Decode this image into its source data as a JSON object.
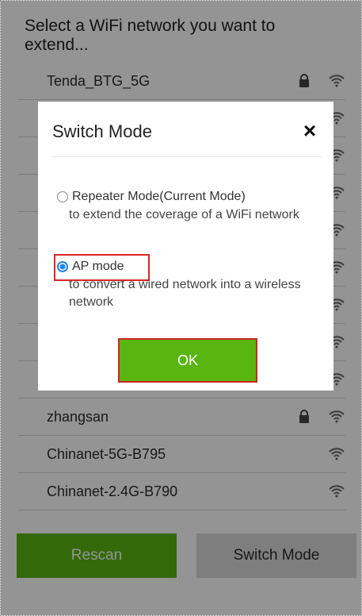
{
  "screen": {
    "title": "Select a WiFi network you want to extend..."
  },
  "networks": [
    {
      "name": "Tenda_BTG_5G",
      "locked": true
    },
    {
      "name": "",
      "locked": false
    },
    {
      "name": "",
      "locked": false
    },
    {
      "name": "",
      "locked": false
    },
    {
      "name": "",
      "locked": false
    },
    {
      "name": "",
      "locked": false
    },
    {
      "name": "",
      "locked": false
    },
    {
      "name": "",
      "locked": false
    },
    {
      "name": "",
      "locked": false
    },
    {
      "name": "zhangsan",
      "locked": true
    },
    {
      "name": "Chinanet-5G-B795",
      "locked": false
    },
    {
      "name": "Chinanet-2.4G-B790",
      "locked": false
    }
  ],
  "footer": {
    "rescan_label": "Rescan",
    "switch_mode_label": "Switch Mode"
  },
  "dialog": {
    "title": "Switch Mode",
    "close_label": "×",
    "repeater_label": "Repeater Mode(Current Mode)",
    "repeater_description": "to extend the coverage of a WiFi network",
    "ap_label": "AP mode",
    "ap_description": "to convert a wired network into a wireless network",
    "ok_label": "OK"
  },
  "colors": {
    "accent_green": "#59b510",
    "selected_blue": "#1c88e7",
    "highlight_red": "#d82727"
  },
  "icons": {
    "lock": "lock-icon",
    "wifi": "wifi-icon",
    "close": "close-icon"
  }
}
